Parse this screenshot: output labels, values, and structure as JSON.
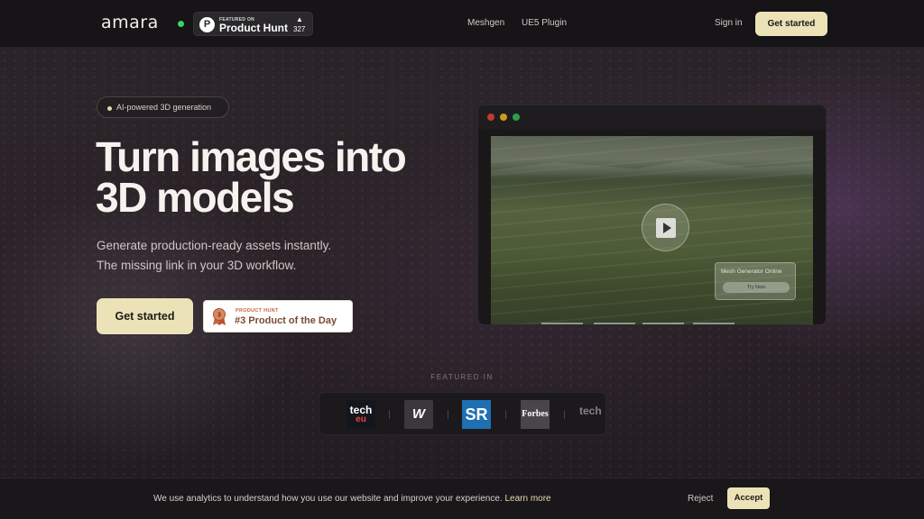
{
  "header": {
    "logo_text": "amara",
    "product_hunt": {
      "small_label": "FEATURED ON",
      "big_label": "Product Hunt",
      "upvote_icon": "triangle-up-icon",
      "count": "327"
    },
    "nav": [
      "Meshgen",
      "UE5 Plugin"
    ],
    "sign_in": "Sign in",
    "cta": "Get started"
  },
  "hero": {
    "pill": "AI-powered 3D generation",
    "headline_line1": "Turn images into",
    "headline_line2": "3D models",
    "sub_line1": "Generate production-ready assets instantly.",
    "sub_line2": "The missing link in your 3D workflow.",
    "cta": "Get started",
    "award": {
      "small_label": "PRODUCT HUNT",
      "big_label": "#3 Product of the Day",
      "medal_number": "3"
    }
  },
  "video": {
    "overlay_title": "Mesh Generator Online",
    "overlay_button": "Try Now",
    "play_icon": "play-icon"
  },
  "featured": {
    "label": "FEATURED IN",
    "logos": [
      {
        "name": "tech-eu",
        "text_top": "tech",
        "text_bottom": "eu"
      },
      {
        "name": "webflow",
        "text": "W"
      },
      {
        "name": "sr",
        "text": "SR"
      },
      {
        "name": "forbes",
        "text": "Forbes"
      },
      {
        "name": "tech-partial",
        "text": "tech"
      }
    ]
  },
  "cookie": {
    "message": "We use analytics to understand how you use our website and improve your experience. ",
    "link": "Learn more",
    "reject": "Reject",
    "accept": "Accept"
  },
  "colors": {
    "accent": "#ece2b8",
    "live": "#3ad26a",
    "traffic_red": "#c0392b",
    "traffic_yellow": "#c99a20",
    "traffic_green": "#2f9e49"
  }
}
